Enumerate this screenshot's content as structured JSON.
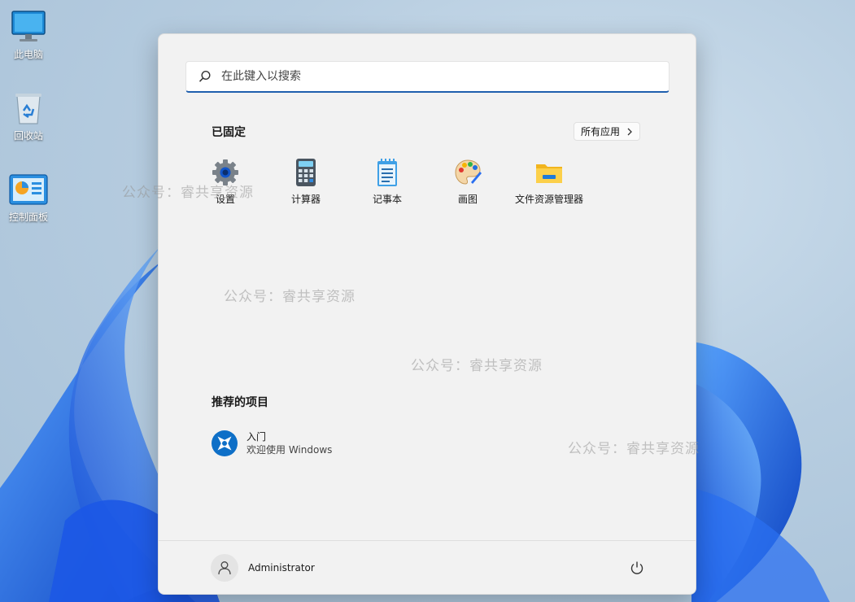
{
  "desktop": {
    "icons": [
      {
        "label": "此电脑",
        "icon": "monitor-icon"
      },
      {
        "label": "回收站",
        "icon": "recycle-bin-icon"
      },
      {
        "label": "控制面板",
        "icon": "control-panel-icon"
      }
    ]
  },
  "watermark": {
    "text": "公众号：睿共享资源"
  },
  "start_menu": {
    "search": {
      "placeholder": "在此键入以搜索",
      "icon": "search-icon"
    },
    "pinned": {
      "title": "已固定",
      "all_apps_label": "所有应用",
      "all_apps_icon": "chevron-right-icon",
      "apps": [
        {
          "label": "设置",
          "icon": "gear-icon"
        },
        {
          "label": "计算器",
          "icon": "calculator-icon"
        },
        {
          "label": "记事本",
          "icon": "notepad-icon"
        },
        {
          "label": "画图",
          "icon": "paint-palette-icon"
        },
        {
          "label": "文件资源管理器",
          "icon": "folder-icon"
        }
      ]
    },
    "recommended": {
      "title": "推荐的项目",
      "items": [
        {
          "title": "入门",
          "subtitle": "欢迎使用 Windows",
          "icon": "get-started-icon"
        }
      ]
    },
    "footer": {
      "user_name": "Administrator",
      "user_icon": "user-icon",
      "power_icon": "power-icon"
    }
  },
  "colors": {
    "accent": "#1f5fae",
    "menu_background": "#f2f2f2",
    "wallpaper_blue": "#1a5fe0"
  }
}
